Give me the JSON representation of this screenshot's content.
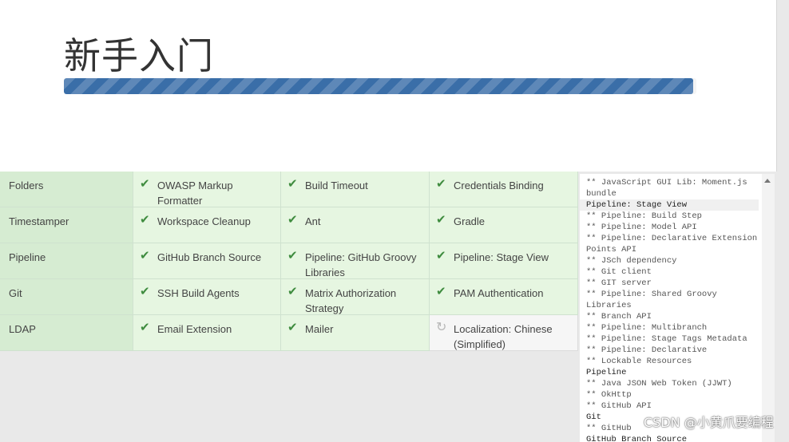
{
  "page": {
    "title": "新手入门",
    "progress": 0.995
  },
  "plugins": [
    [
      {
        "name": "Folders",
        "status": "done"
      },
      {
        "name": "OWASP Markup Formatter",
        "status": "done"
      },
      {
        "name": "Build Timeout",
        "status": "done"
      },
      {
        "name": "Credentials Binding",
        "status": "done"
      }
    ],
    [
      {
        "name": "Timestamper",
        "status": "done"
      },
      {
        "name": "Workspace Cleanup",
        "status": "done"
      },
      {
        "name": "Ant",
        "status": "done"
      },
      {
        "name": "Gradle",
        "status": "done"
      }
    ],
    [
      {
        "name": "Pipeline",
        "status": "done"
      },
      {
        "name": "GitHub Branch Source",
        "status": "done"
      },
      {
        "name": "Pipeline: GitHub Groovy Libraries",
        "status": "done"
      },
      {
        "name": "Pipeline: Stage View",
        "status": "done"
      }
    ],
    [
      {
        "name": "Git",
        "status": "done"
      },
      {
        "name": "SSH Build Agents",
        "status": "done"
      },
      {
        "name": "Matrix Authorization Strategy",
        "status": "done"
      },
      {
        "name": "PAM Authentication",
        "status": "done"
      }
    ],
    [
      {
        "name": "LDAP",
        "status": "done"
      },
      {
        "name": "Email Extension",
        "status": "done"
      },
      {
        "name": "Mailer",
        "status": "done"
      },
      {
        "name": "Localization: Chinese (Simplified)",
        "status": "pending"
      }
    ]
  ],
  "icons": {
    "done": "check-icon",
    "pending": "refresh-icon"
  },
  "log": [
    {
      "text": "** JavaScript GUI Lib: Moment.js bundle",
      "type": "dep"
    },
    {
      "text": "Pipeline: Stage View",
      "type": "head",
      "hl": true
    },
    {
      "text": "** Pipeline: Build Step",
      "type": "dep"
    },
    {
      "text": "** Pipeline: Model API",
      "type": "dep"
    },
    {
      "text": "** Pipeline: Declarative Extension Points API",
      "type": "dep"
    },
    {
      "text": "** JSch dependency",
      "type": "dep"
    },
    {
      "text": "** Git client",
      "type": "dep"
    },
    {
      "text": "** GIT server",
      "type": "dep"
    },
    {
      "text": "** Pipeline: Shared Groovy Libraries",
      "type": "dep"
    },
    {
      "text": "** Branch API",
      "type": "dep"
    },
    {
      "text": "** Pipeline: Multibranch",
      "type": "dep"
    },
    {
      "text": "** Pipeline: Stage Tags Metadata",
      "type": "dep"
    },
    {
      "text": "** Pipeline: Declarative",
      "type": "dep"
    },
    {
      "text": "** Lockable Resources",
      "type": "dep"
    },
    {
      "text": "Pipeline",
      "type": "head"
    },
    {
      "text": "** Java JSON Web Token (JJWT)",
      "type": "dep"
    },
    {
      "text": "** OkHttp",
      "type": "dep"
    },
    {
      "text": "** GitHub API",
      "type": "dep"
    },
    {
      "text": "Git",
      "type": "head"
    },
    {
      "text": "** GitHub",
      "type": "dep"
    },
    {
      "text": "GitHub Branch Source",
      "type": "head"
    }
  ],
  "watermark": "CSDN @小黄爪要编程",
  "colors": {
    "done_bg": "#e6f6e1",
    "done_bg_first_col": "#d6ecd2",
    "check": "#3f8c3f",
    "progress": "#3a6ea8"
  }
}
